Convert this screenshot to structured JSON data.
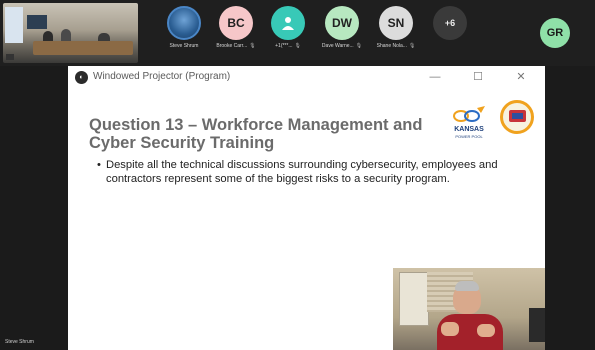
{
  "participants": [
    {
      "name": "Steve Shrum",
      "type": "photo"
    },
    {
      "initials": "BC",
      "name": "Brooke Carr...",
      "color": "#f6c7c9"
    },
    {
      "name": "+1(***...",
      "type": "person-icon",
      "color": "#38c9b7"
    },
    {
      "initials": "DW",
      "name": "Dave Warne...",
      "color": "#b7e8c0"
    },
    {
      "initials": "SN",
      "name": "Shane Nola...",
      "color": "#dcdcdc"
    },
    {
      "initials": "+6",
      "name": "",
      "color": "#3a3a3a"
    }
  ],
  "self_initials": "GR",
  "window": {
    "title": "Windowed Projector (Program)",
    "minimize": "—",
    "maximize": "☐",
    "close": "✕"
  },
  "slide": {
    "title": "Question 13 – Workforce Management and Cyber Security Training",
    "bullet": "Despite all the technical discussions surrounding cybersecurity, employees and contractors represent some of the biggest risks to a security program.",
    "logo_text": "KANSAS",
    "logo_subtext": "POWER POOL"
  },
  "bottom_label": "Steve Shrum"
}
